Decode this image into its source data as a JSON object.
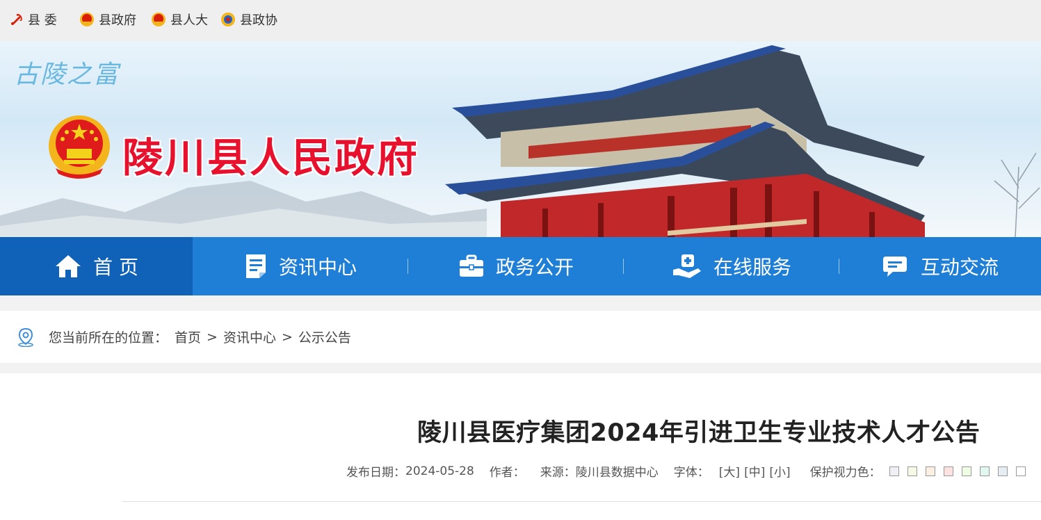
{
  "topbar": {
    "links": [
      {
        "label": "县 委",
        "icon": "party-emblem-icon"
      },
      {
        "label": "县政府",
        "icon": "national-emblem-icon"
      },
      {
        "label": "县人大",
        "icon": "national-emblem-icon"
      },
      {
        "label": "县政协",
        "icon": "cppcc-emblem-icon"
      }
    ]
  },
  "banner": {
    "slogan": "古陵之富",
    "site_title": "陵川县人民政府"
  },
  "nav": {
    "items": [
      {
        "label": "首 页",
        "icon": "home-icon",
        "active": true
      },
      {
        "label": "资讯中心",
        "icon": "document-icon",
        "active": false
      },
      {
        "label": "政务公开",
        "icon": "briefcase-icon",
        "active": false
      },
      {
        "label": "在线服务",
        "icon": "service-hand-icon",
        "active": false
      },
      {
        "label": "互动交流",
        "icon": "chat-icon",
        "active": false
      }
    ]
  },
  "breadcrumb": {
    "prefix": "您当前所在的位置：",
    "items": [
      "首页",
      "资讯中心",
      "公示公告"
    ],
    "separator": ">"
  },
  "article": {
    "title": "陵川县医疗集团2024年引进卫生专业技术人才公告",
    "date_label": "发布日期：",
    "date": "2024-05-28",
    "author_label": "作者：",
    "author": "",
    "source_label": "来源：",
    "source": "陵川县数据中心",
    "font_label": "字体：",
    "font_sizes": [
      "[大]",
      "[中]",
      "[小]"
    ],
    "eye_care_label": "保护视力色：",
    "eye_care_colors": [
      "#eef0f5",
      "#f8f8e6",
      "#fbefe4",
      "#fde2e2",
      "#eefde4",
      "#e2f7ef",
      "#e6eef3",
      "#ffffff"
    ]
  },
  "colors": {
    "nav_bg": "#1f7fd6",
    "nav_active": "#0f62b8",
    "title_red": "#e8112d"
  }
}
